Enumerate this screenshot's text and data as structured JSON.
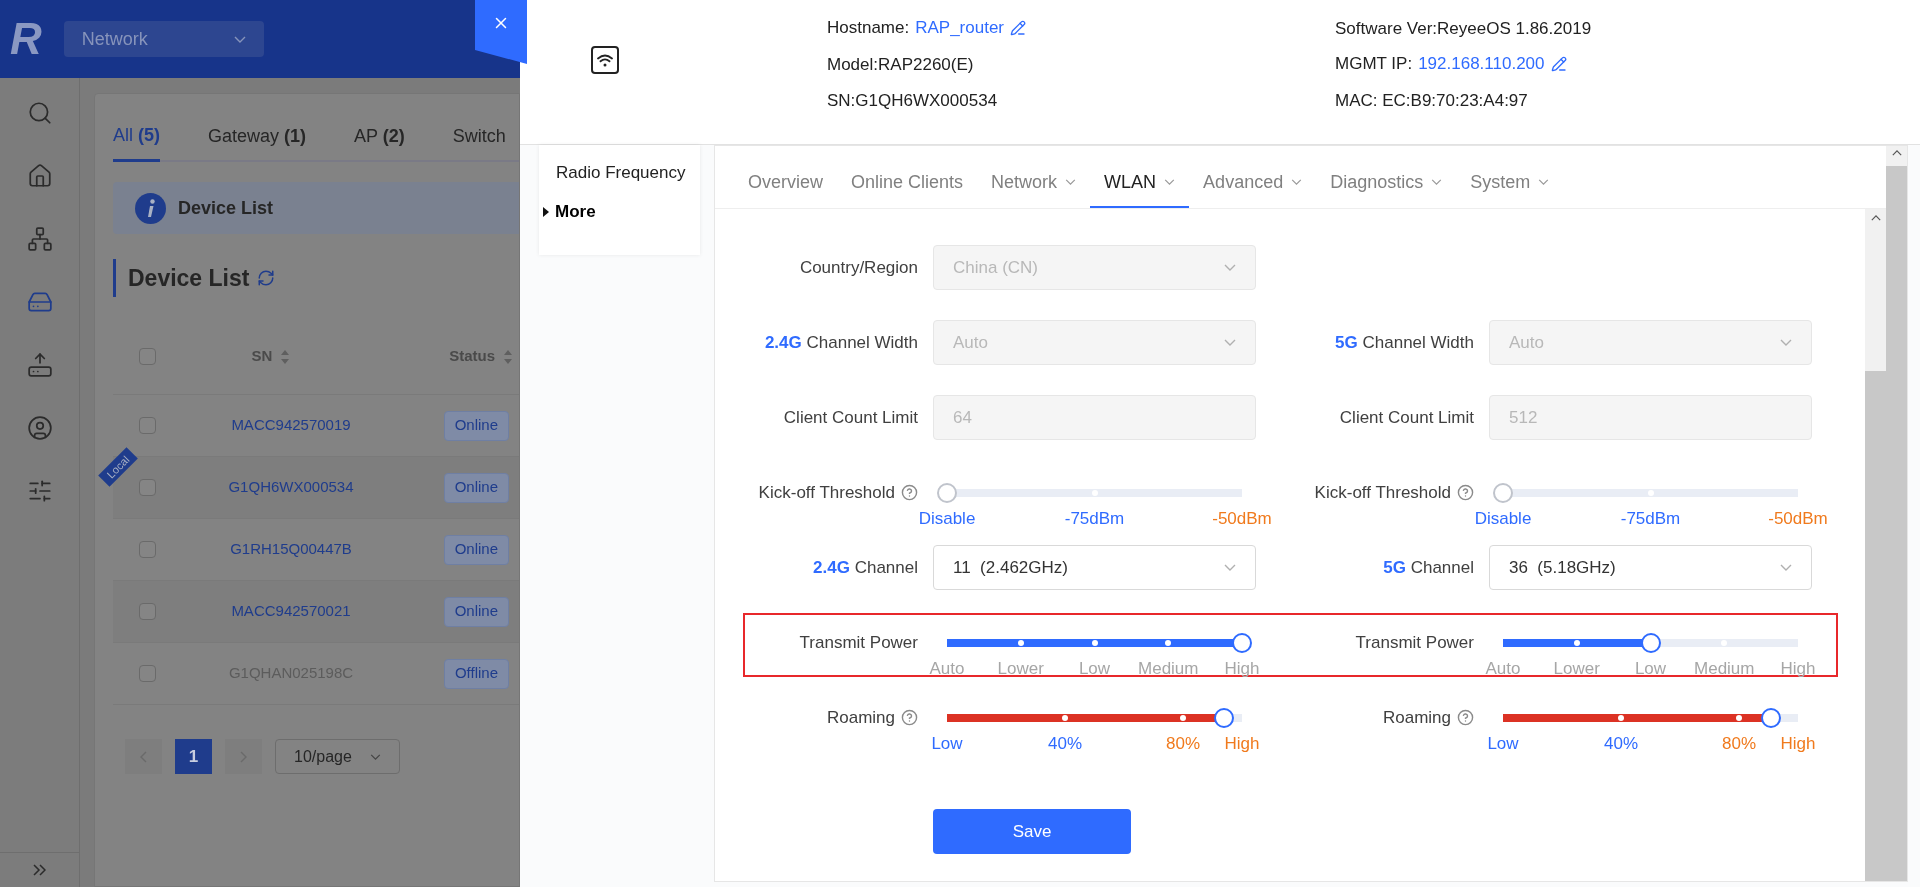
{
  "background": {
    "logo": "R",
    "nav_dropdown": "Network",
    "sidebar_items": [
      {
        "selected": false
      },
      {
        "selected": false
      },
      {
        "selected": false
      },
      {
        "selected": true
      },
      {
        "selected": false
      },
      {
        "selected": false
      },
      {
        "selected": false
      }
    ],
    "tabs": [
      {
        "label": "All",
        "count": "(5)",
        "selected": true
      },
      {
        "label": "Gateway",
        "count": "(1)",
        "selected": false
      },
      {
        "label": "AP",
        "count": "(2)",
        "selected": false
      },
      {
        "label": "Switch",
        "selected": false
      }
    ],
    "info_banner": "Device List",
    "section_title": "Device List",
    "table": {
      "columns": [
        "SN",
        "Status"
      ],
      "select_all": {
        "checked": false
      },
      "rows": [
        {
          "sn": "MACC942570019",
          "status": "Online",
          "online": true,
          "checked": false
        },
        {
          "sn": "G1QH6WX000534",
          "status": "Online",
          "online": true,
          "checked": false,
          "badge": "Local"
        },
        {
          "sn": "G1RH15Q00447B",
          "status": "Online",
          "online": true,
          "checked": false
        },
        {
          "sn": "MACC942570021",
          "status": "Online",
          "online": true,
          "checked": false
        },
        {
          "sn": "G1QHAN025198C",
          "status": "Offline",
          "online": false,
          "checked": false
        }
      ]
    },
    "pagination": {
      "pages": [
        {
          "label": "1",
          "selected": true
        }
      ],
      "page_size": "10/page"
    }
  },
  "device": {
    "hostname_label": "Hostname:",
    "hostname": "RAP_router",
    "model": "Model:RAP2260(E)",
    "sn": "SN:G1QH6WX000534",
    "software": "Software Ver:ReyeeOS 1.86.2019",
    "mgmt_label": "MGMT IP:",
    "mgmt_ip": "192.168.110.200",
    "mac": "MAC: EC:B9:70:23:A4:97"
  },
  "side_menu": [
    {
      "label": "Radio Frequency",
      "kind": "link"
    },
    {
      "label": "More",
      "kind": "expander",
      "expanded": false
    }
  ],
  "tabs": [
    {
      "label": "Overview",
      "dropdown": false,
      "selected": false
    },
    {
      "label": "Online Clients",
      "dropdown": false,
      "selected": false
    },
    {
      "label": "Network",
      "dropdown": true,
      "selected": false
    },
    {
      "label": "WLAN",
      "dropdown": true,
      "selected": true
    },
    {
      "label": "Advanced",
      "dropdown": true,
      "selected": false
    },
    {
      "label": "Diagnostics",
      "dropdown": true,
      "selected": false
    },
    {
      "label": "System",
      "dropdown": true,
      "selected": false
    }
  ],
  "form": {
    "rows": [
      {
        "left": {
          "kind": "select",
          "label": "Country/Region",
          "value": "China (CN)",
          "disabled": true
        }
      },
      {
        "left": {
          "kind": "select",
          "label": "**2.4G** Channel Width",
          "value": "Auto",
          "disabled": true
        },
        "right": {
          "kind": "select",
          "label": "**5G** Channel Width",
          "value": "Auto",
          "disabled": true
        }
      },
      {
        "left": {
          "kind": "input",
          "label": "Client Count Limit",
          "value": "64",
          "disabled": true
        },
        "right": {
          "kind": "input",
          "label": "Client Count Limit",
          "value": "512",
          "disabled": true
        }
      },
      {
        "left": {
          "kind": "slider",
          "label": "Kick-off Threshold",
          "help": true,
          "level": 0,
          "marks": [
            {
              "label": "Disable",
              "color": "#2f6bff"
            },
            {
              "label": "-75dBm",
              "color": "#2f6bff"
            },
            {
              "label": "-50dBm",
              "color": "#f07a1d"
            }
          ]
        },
        "right": {
          "kind": "slider",
          "label": "Kick-off Threshold",
          "help": true,
          "level": 0,
          "marks": [
            {
              "label": "Disable",
              "color": "#2f6bff"
            },
            {
              "label": "-75dBm",
              "color": "#2f6bff"
            },
            {
              "label": "-50dBm",
              "color": "#f07a1d"
            }
          ]
        }
      },
      {
        "left": {
          "kind": "select",
          "label": "**2.4G** Channel",
          "value": "11  (2.462GHz)",
          "disabled": false
        },
        "right": {
          "kind": "select",
          "label": "**5G** Channel",
          "value": "36  (5.18GHz)",
          "disabled": false
        }
      },
      {
        "highlighted": true,
        "left": {
          "kind": "slider",
          "label": "Transmit Power",
          "level": 1,
          "color": "#2f6bff",
          "marks": [
            {
              "label": "Auto",
              "color": "#a6a6a6"
            },
            {
              "label": "Lower",
              "color": "#a6a6a6"
            },
            {
              "label": "Low",
              "color": "#a6a6a6"
            },
            {
              "label": "Medium",
              "color": "#a6a6a6"
            },
            {
              "label": "High",
              "color": "#a6a6a6"
            }
          ]
        },
        "right": {
          "kind": "slider",
          "label": "Transmit Power",
          "level": 0.5,
          "color": "#2f6bff",
          "marks": [
            {
              "label": "Auto",
              "color": "#a6a6a6"
            },
            {
              "label": "Lower",
              "color": "#a6a6a6"
            },
            {
              "label": "Low",
              "color": "#a6a6a6"
            },
            {
              "label": "Medium",
              "color": "#a6a6a6"
            },
            {
              "label": "High",
              "color": "#a6a6a6"
            }
          ]
        }
      },
      {
        "left": {
          "kind": "graded",
          "label": "Roaming",
          "help": true,
          "level": 0.94,
          "color": "#dc3224",
          "marks": [
            {
              "label": "Low",
              "color": "#2f6bff"
            },
            {
              "label": "40%",
              "color": "#2f6bff"
            },
            {
              "label": "80%",
              "color": "#f07a1d"
            },
            {
              "label": "High",
              "color": "#f07a1d"
            }
          ]
        },
        "right": {
          "kind": "graded",
          "label": "Roaming",
          "help": true,
          "level": 0.91,
          "color": "#dc3224",
          "marks": [
            {
              "label": "Low",
              "color": "#2f6bff"
            },
            {
              "label": "40%",
              "color": "#2f6bff"
            },
            {
              "label": "80%",
              "color": "#f07a1d"
            },
            {
              "label": "High",
              "color": "#f07a1d"
            }
          ]
        }
      }
    ],
    "save_button": "Save"
  }
}
